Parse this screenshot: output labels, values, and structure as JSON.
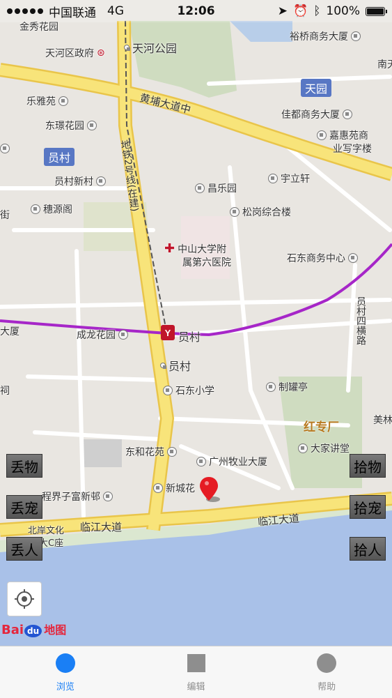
{
  "status_bar": {
    "carrier": "中国联通",
    "network": "4G",
    "time": "12:06",
    "battery": "100%"
  },
  "map": {
    "districts": [
      "天园",
      "员村"
    ],
    "pois": [
      {
        "label": "天河区政府"
      },
      {
        "label": "天河公园"
      },
      {
        "label": "裕桥商务大厦"
      },
      {
        "label": "乐雅苑"
      },
      {
        "label": "佳都商务大厦"
      },
      {
        "label": "东璟花园"
      },
      {
        "label": "嘉惠苑商"
      },
      {
        "label": "业写字楼"
      },
      {
        "label": "员村新村"
      },
      {
        "label": "宇立轩"
      },
      {
        "label": "昌乐园"
      },
      {
        "label": "穗源阁"
      },
      {
        "label": "松岗综合楼"
      },
      {
        "label": "中山大学附"
      },
      {
        "label": "属第六医院"
      },
      {
        "label": "石东商务中心"
      },
      {
        "label": "成龙花园"
      },
      {
        "label": "员村"
      },
      {
        "label": "员村"
      },
      {
        "label": "石东小学"
      },
      {
        "label": "制罐亭"
      },
      {
        "label": "大家讲堂"
      },
      {
        "label": "东和花苑"
      },
      {
        "label": "广州牧业大厦"
      },
      {
        "label": "新城花"
      },
      {
        "label": "程界子富新邨"
      },
      {
        "label": "北岸文化"
      },
      {
        "label": "大C座"
      },
      {
        "label": "金秀花园"
      },
      {
        "label": "南天"
      },
      {
        "label": "大厦"
      },
      {
        "label": "街"
      },
      {
        "label": "祠"
      },
      {
        "label": "美林"
      }
    ],
    "roads": [
      "黄埔大道中",
      "地铁2号线(在建)",
      "员村四横路",
      "临江大道",
      "临江大道"
    ],
    "highlight": "红专厂"
  },
  "side_buttons": {
    "left": [
      "丢物",
      "丢宠",
      "丢人"
    ],
    "right": [
      "拾物",
      "拾宠",
      "拾人"
    ]
  },
  "logo": {
    "bai": "Bai",
    "du": "du",
    "map": "地图"
  },
  "tabs": [
    {
      "label": "浏览",
      "icon": "circle-icon",
      "active": true
    },
    {
      "label": "编辑",
      "icon": "square-icon",
      "active": false
    },
    {
      "label": "帮助",
      "icon": "circle-icon",
      "active": false
    }
  ],
  "colors": {
    "accent": "#1a7ff5",
    "road_yellow": "#f6d84b",
    "metro_purple": "#a626c8",
    "water": "#a9c1e8"
  }
}
